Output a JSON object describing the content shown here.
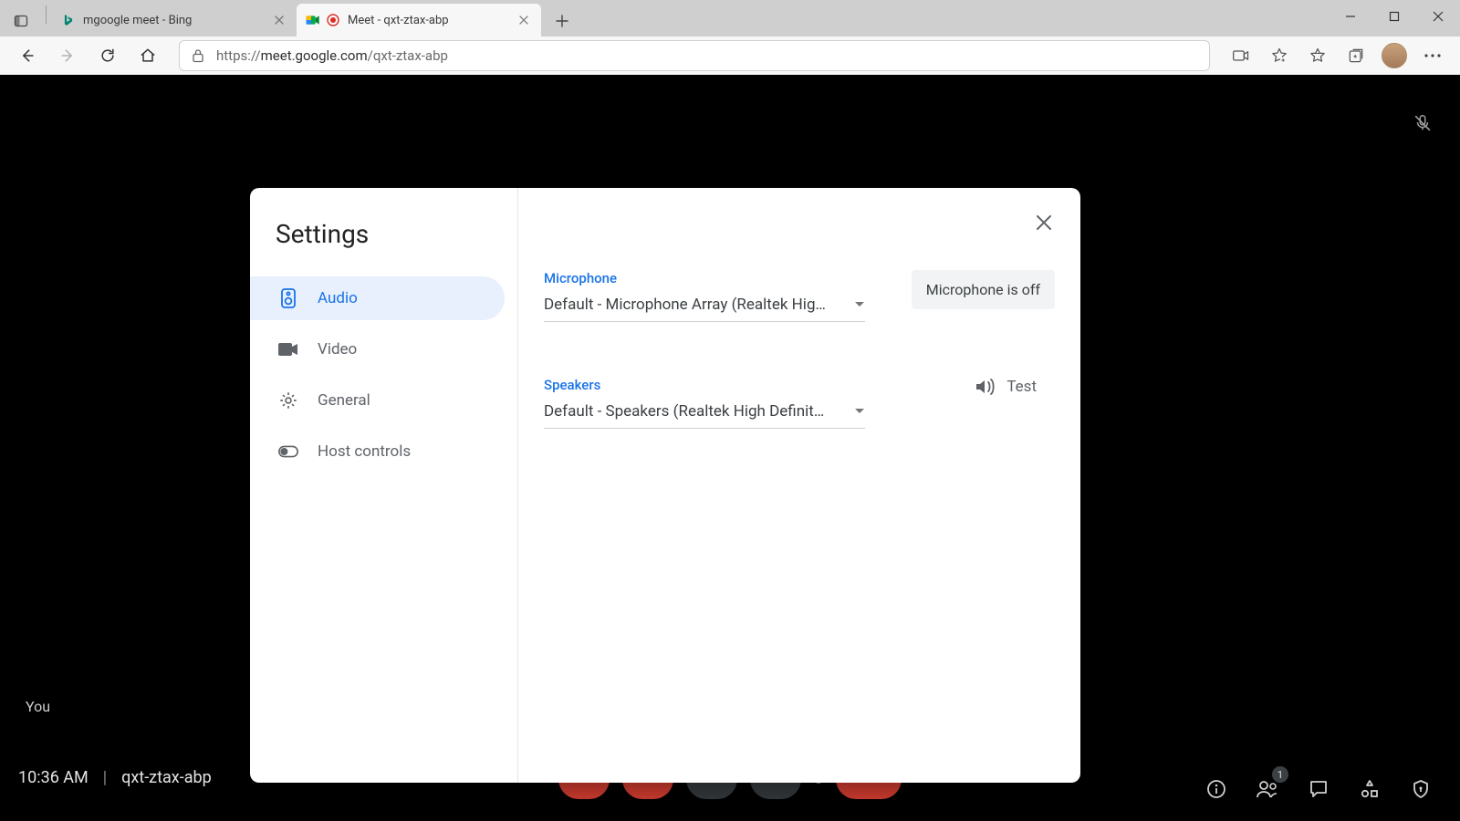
{
  "browser": {
    "tabs": [
      {
        "title": "mgoogle meet - Bing",
        "favicon": "bing"
      },
      {
        "title": "Meet - qxt-ztax-abp",
        "favicon": "meet"
      }
    ],
    "url_prefix": "https://",
    "url_host": "meet.google.com",
    "url_path": "/qxt-ztax-abp"
  },
  "meet": {
    "you_label": "You",
    "time": "10:36 AM",
    "room": "qxt-ztax-abp",
    "people_badge": "1"
  },
  "dialog": {
    "title": "Settings",
    "nav": {
      "audio": "Audio",
      "video": "Video",
      "general": "General",
      "host": "Host controls"
    },
    "audio": {
      "mic_label": "Microphone",
      "mic_value": "Default - Microphone Array (Realtek High …",
      "mic_status": "Microphone is off",
      "spk_label": "Speakers",
      "spk_value": "Default - Speakers (Realtek High Definitio…",
      "test_label": "Test"
    }
  }
}
